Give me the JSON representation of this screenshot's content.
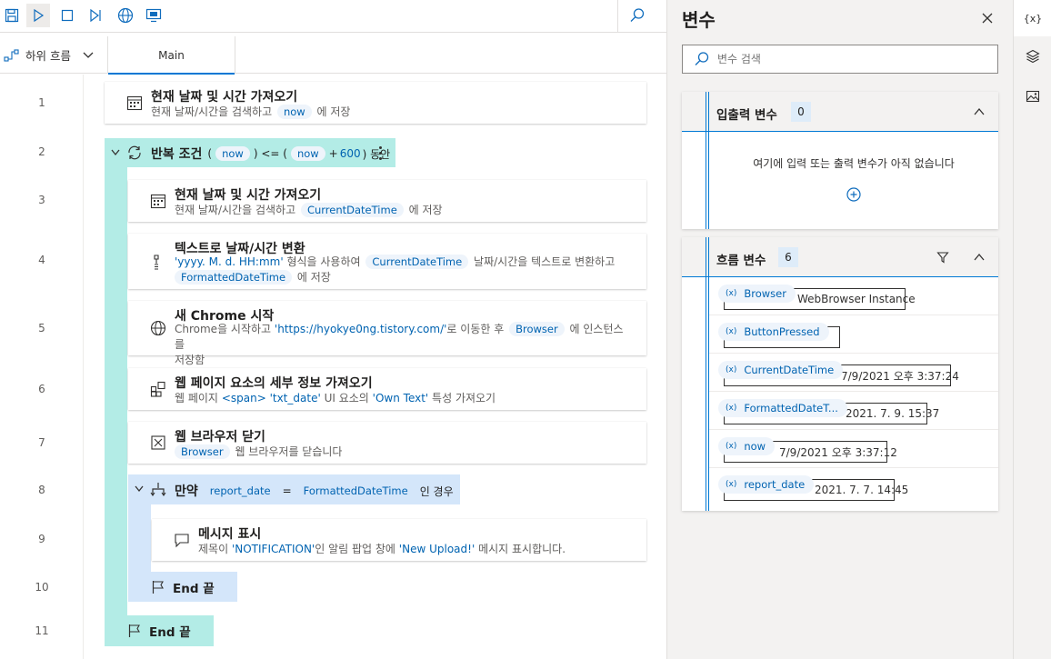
{
  "toolbar": {
    "buttons": [
      "save-icon",
      "play-icon",
      "stop-icon",
      "step-icon",
      "globe-icon",
      "monitor-icon"
    ],
    "search_icon": "search-icon"
  },
  "tabs": {
    "subflow_label": "하위 흐름",
    "main_tab": "Main"
  },
  "lines": [
    "1",
    "2",
    "3",
    "4",
    "5",
    "6",
    "7",
    "8",
    "9",
    "10",
    "11"
  ],
  "actions": {
    "a1": {
      "title": "현재 날짜 및 시간 가져오기",
      "d_pre": "현재 날짜/시간을 검색하고",
      "var": "now",
      "d_post": "에 저장"
    },
    "loop": {
      "title": "반복 조건",
      "p1": "(",
      "var1": "now",
      "op": ") <= (",
      "var2": "now",
      "tail_op": "+",
      "num": "600",
      "tail": ") 동안"
    },
    "a3": {
      "title": "현재 날짜 및 시간 가져오기",
      "d_pre": "현재 날짜/시간을 검색하고",
      "var": "CurrentDateTime",
      "d_post": "에 저장"
    },
    "a4": {
      "title": "텍스트로 날짜/시간 변환",
      "fmt": "'yyyy. M. d. HH:mm'",
      "d1": "형식을 사용하여",
      "var1": "CurrentDateTime",
      "d2": "날짜/시간을 텍스트로 변환하고",
      "var2": "FormattedDateTime",
      "d3": "에 저장"
    },
    "a5": {
      "title": "새 Chrome 시작",
      "d1": "Chrome을 시작하고",
      "url": "'https://hyokye0ng.tistory.com/'",
      "d2": "로 이동한 후",
      "var": "Browser",
      "d3": "에 인스턴스를",
      "d4": "저장함"
    },
    "a6": {
      "title": "웹 페이지 요소의 세부 정보 가져오기",
      "d1": "웹 페이지",
      "el": "<span>",
      "id": "'txt_date'",
      "d2": "UI 요소의",
      "attr": "'Own Text'",
      "d3": "특성 가져오기"
    },
    "a7": {
      "title": "웹 브라우저 닫기",
      "var": "Browser",
      "d1": "웹 브라우저를 닫습니다"
    },
    "if": {
      "title": "만약",
      "var1": "report_date",
      "op": "=",
      "var2": "FormattedDateTime",
      "tail": "인 경우"
    },
    "a9": {
      "title": "메시지 표시",
      "d1": "제목이",
      "t1": "'NOTIFICATION'",
      "d2": "인 알림 팝업 창에",
      "t2": "'New Upload!'",
      "d3": "메시지 표시합니다."
    },
    "end10": "End 끝",
    "end11": "End 끝"
  },
  "variables": {
    "title": "변수",
    "search_placeholder": "변수 검색",
    "io": {
      "label": "입출력 변수",
      "count": "0",
      "empty": "여기에 입력 또는 출력 변수가 아직 없습니다"
    },
    "flow": {
      "label": "흐름 변수",
      "count": "6",
      "items": [
        {
          "name": "Browser",
          "value": "WebBrowser Instance"
        },
        {
          "name": "ButtonPressed",
          "value": ""
        },
        {
          "name": "CurrentDateTime",
          "value": "7/9/2021 오후 3:37:24"
        },
        {
          "name": "FormattedDateT...",
          "value": "2021. 7. 9. 15:37"
        },
        {
          "name": "now",
          "value": "7/9/2021 오후 3:37:12"
        },
        {
          "name": "report_date",
          "value": "2021. 7. 7. 14:45"
        }
      ]
    },
    "var_tag": "(x)"
  },
  "right_sidebar": {
    "vars_button": "{x}"
  }
}
